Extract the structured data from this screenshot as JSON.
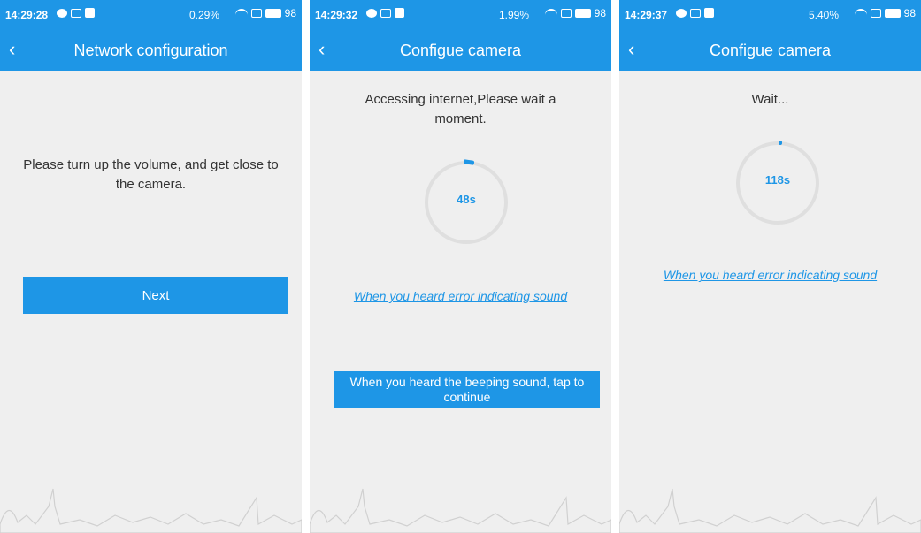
{
  "colors": {
    "accent": "#1e96e6",
    "background": "#efefef",
    "ring_track": "#dfdfdf",
    "text": "#333333"
  },
  "screens": [
    {
      "status": {
        "time": "14:29:28",
        "rate": "0.29",
        "battery": "98"
      },
      "back_icon": "chevron-left-icon",
      "title": "Network configuration",
      "message": "Please turn up the volume, and get close to the camera.",
      "next_label": "Next"
    },
    {
      "status": {
        "time": "14:29:32",
        "rate": "1.99",
        "battery": "98"
      },
      "back_icon": "chevron-left-icon",
      "title": "Configue camera",
      "message": "Accessing internet,Please wait a moment.",
      "countdown": "48s",
      "error_link": "When you heard error indicating sound",
      "continue_label": "When you heard the beeping sound, tap to continue"
    },
    {
      "status": {
        "time": "14:29:37",
        "rate": "5.40",
        "battery": "98"
      },
      "back_icon": "chevron-left-icon",
      "title": "Configue camera",
      "message": "Wait...",
      "countdown": "118s",
      "error_link": "When you heard error indicating sound"
    }
  ]
}
